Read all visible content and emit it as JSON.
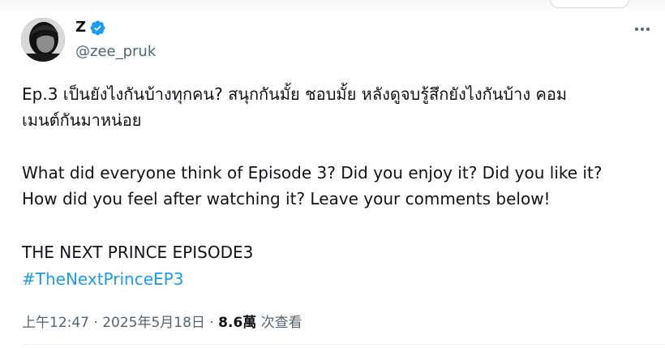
{
  "author": {
    "display_name": "Z",
    "handle": "@zee_pruk",
    "verified": true
  },
  "tweet": {
    "thai_line_1": "Ep.3 เป็นยังไงกันบ้างทุกคน? สนุกกันมั้ย ชอบมั้ย หลังดูจบรู้สึกยังไงกันบ้าง คอม",
    "thai_line_2": "เมนต์กันมาหน่อย",
    "english_line_1": "What did everyone think of Episode 3? Did you enjoy it? Did you like it?",
    "english_line_2": "How did you feel after watching it? Leave your comments below!",
    "title_line": "THE NEXT PRINCE EPISODE3",
    "hashtag": "#TheNextPrinceEP3"
  },
  "meta": {
    "time": "上午12:47",
    "separator": "·",
    "date": "2025年5月18日",
    "views_count": "8.6萬",
    "views_label": "次查看"
  },
  "icons": {
    "verified": "verified-badge-icon",
    "more": "more-options-icon"
  },
  "colors": {
    "text": "#0f1419",
    "secondary": "#536471",
    "accent": "#1d9bf0"
  }
}
